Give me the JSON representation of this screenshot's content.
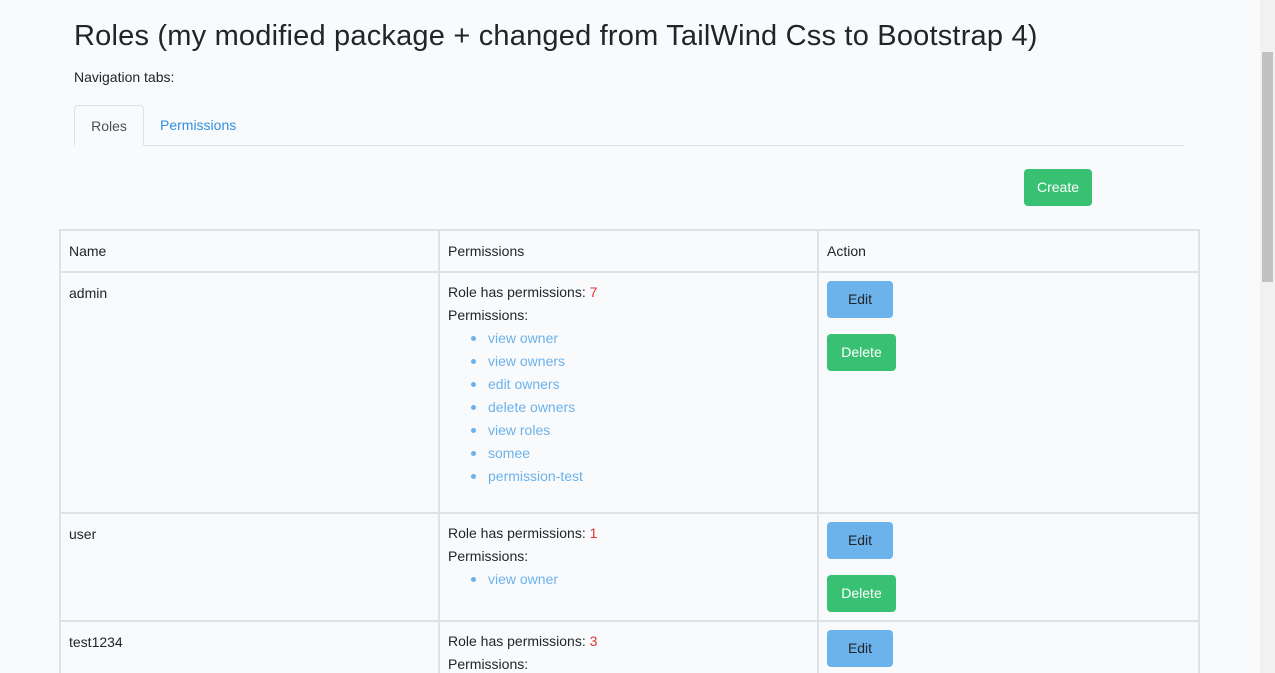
{
  "page": {
    "title": "Roles (my modified package + changed from TailWind Css to Bootstrap 4)",
    "nav_label": "Navigation tabs:"
  },
  "tabs": [
    {
      "label": "Roles",
      "active": true
    },
    {
      "label": "Permissions",
      "active": false
    }
  ],
  "toolbar": {
    "create_label": "Create"
  },
  "table": {
    "headers": [
      "Name",
      "Permissions",
      "Action"
    ],
    "count_prefix": "Role has permissions: ",
    "permissions_label": "Permissions:",
    "edit_label": "Edit",
    "delete_label": "Delete",
    "rows": [
      {
        "name": "admin",
        "count": "7",
        "permissions": [
          "view owner",
          "view owners",
          "edit owners",
          "delete owners",
          "view roles",
          "somee",
          "permission-test"
        ]
      },
      {
        "name": "user",
        "count": "1",
        "permissions": [
          "view owner"
        ]
      },
      {
        "name": "test1234",
        "count": "3",
        "permissions": []
      }
    ]
  },
  "colors": {
    "background": "#f8fafc",
    "primary_link": "#3490dc",
    "info": "#6cb2eb",
    "success": "#38c172",
    "danger_count": "#e3342f",
    "border": "#dee2e6"
  }
}
